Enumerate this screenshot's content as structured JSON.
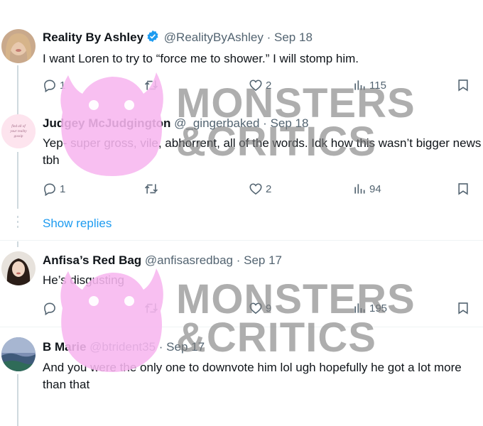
{
  "tweets": [
    {
      "name": "Reality By Ashley",
      "handle": "@RealityByAshley",
      "date": "Sep 18",
      "text": "I want Loren to try to “force me to shower.” I will stomp him.",
      "replies": "1",
      "retweets": "",
      "likes": "2",
      "views": "115",
      "verified": true
    },
    {
      "name": "Judgey McJudgington",
      "handle": "@_gingerbaked",
      "date": "Sep 18",
      "text": "Yep- super gross, vile, abhorrent, all of the words. Idk how this wasn’t bigger news tbh",
      "replies": "1",
      "retweets": "",
      "likes": "2",
      "views": "94",
      "avatar_text": "find all of your reality gossip"
    },
    {
      "name": "Anfisa’s Red Bag",
      "handle": "@anfisasredbag",
      "date": "Sep 17",
      "text": "He’s disgusting",
      "replies": "",
      "retweets": "",
      "likes": "9",
      "views": "195"
    },
    {
      "name": "B Marie",
      "handle": "@btrident35",
      "date": "Sep 17",
      "text": "And you were the only one to downvote him lol ugh hopefully he got a lot more than that"
    }
  ],
  "show_replies": "Show replies",
  "separator": "·",
  "watermark": {
    "line1": "MONSTERS",
    "line2": "&CRITICS"
  },
  "colors": {
    "text": "#0f1419",
    "secondary": "#536471",
    "link": "#1d9bf0",
    "verified": "#1d9bf0",
    "watermark_pink": "#f7b6ef"
  }
}
